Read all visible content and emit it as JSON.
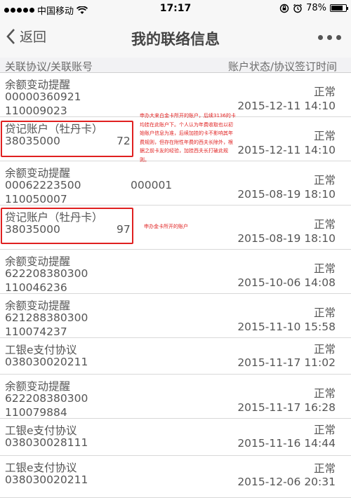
{
  "status_bar": {
    "carrier": "中国移动",
    "time": "17:17",
    "battery": "78%",
    "battery_level": 0.78
  },
  "nav": {
    "back_label": "返回",
    "title": "我的联络信息"
  },
  "columns": {
    "left": "关联协议/关联账号",
    "right": "账户状态/协议签订时间"
  },
  "rows": [
    {
      "name": "余额变动提醒",
      "line2": "00000360921",
      "line3": "110009023",
      "status": "正常",
      "time": "2015-12-11 14:10"
    },
    {
      "name": "贷记账户（牡丹卡）",
      "line2": "38035000",
      "tail": "72",
      "status": "正常",
      "time": "2015-12-11 14:10"
    },
    {
      "name": "余额变动提醒",
      "line2": "00062223500",
      "mid": "000001",
      "line3": "110050007",
      "status": "正常",
      "time": "2015-08-19 18:10"
    },
    {
      "name": "贷记账户（牡丹卡）",
      "line2": "38035000",
      "tail": "97",
      "status": "正常",
      "time": "2015-08-19 18:10"
    },
    {
      "name": "余额变动提醒",
      "line2": "622208380300",
      "line3": "110046236",
      "status": "正常",
      "time": "2015-10-06 14:08"
    },
    {
      "name": "余额变动提醒",
      "line2": "621288380300",
      "line3": "110074237",
      "status": "正常",
      "time": "2015-11-10 15:58"
    },
    {
      "name": "工银e支付协议",
      "line2": "038030020211",
      "status": "正常",
      "time": "2015-11-17 11:02"
    },
    {
      "name": "余额变动提醒",
      "line2": "622208380300",
      "line3": "110079884",
      "status": "正常",
      "time": "2015-11-17 16:28"
    },
    {
      "name": "工银e支付协议",
      "line2": "038030028111",
      "status": "正常",
      "time": "2015-11-16 14:44"
    },
    {
      "name": "工银e支付协议",
      "line2": "038030020211",
      "status": "正常",
      "time": "2015-12-06 20:31"
    }
  ],
  "annotations": {
    "note1": [
      "申办大来白金卡所开的账户，后续3136的卡",
      "均挂在此账户下。个人认为年费收取也以初",
      "始账户信息为准，后续加挂的卡不影响其年",
      "费规则，但存在附性年费的西夫长除外，根",
      "据之前卡友的经验，加挂西夫长打破此规",
      "则。"
    ],
    "note2": "申办金卡所开的账户",
    "color": "#e02020"
  }
}
